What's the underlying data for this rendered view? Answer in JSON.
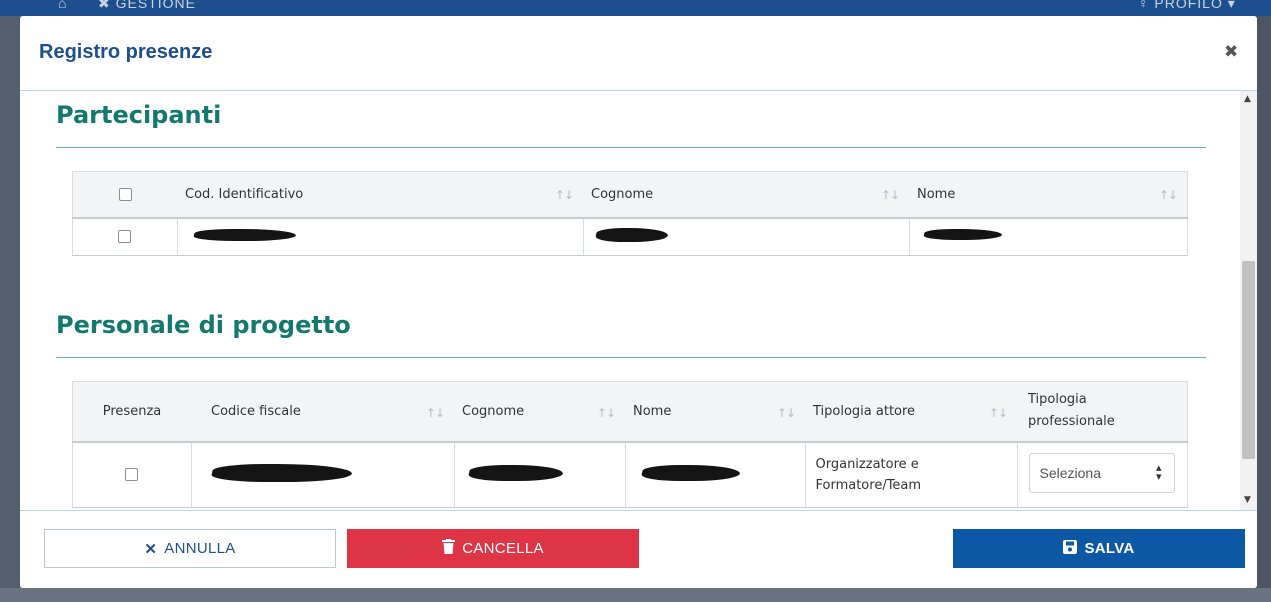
{
  "background": {
    "gestione_label": "GESTIONE",
    "profilo_label": "PROFILO"
  },
  "modal": {
    "title": "Registro presenze",
    "close_icon": "close-icon"
  },
  "partecipanti": {
    "title": "Partecipanti",
    "columns": [
      "Cod. Identificativo",
      "Cognome",
      "Nome"
    ],
    "rows": [
      {
        "selected": false,
        "cod": "",
        "cognome": "",
        "nome": ""
      }
    ]
  },
  "personale": {
    "title": "Personale di progetto",
    "columns": [
      "Presenza",
      "Codice fiscale",
      "Cognome",
      "Nome",
      "Tipologia attore",
      "Tipologia professionale"
    ],
    "rows": [
      {
        "presenza": false,
        "codice_fiscale": "",
        "cognome": "",
        "nome": "",
        "tipologia_attore_line1": "Organizzatore e",
        "tipologia_attore_line2": "Formatore/Team",
        "tipologia_professionale": "Seleziona"
      }
    ]
  },
  "footer": {
    "annulla_label": "ANNULLA",
    "cancella_label": "CANCELLA",
    "salva_label": "SALVA"
  },
  "colors": {
    "primary": "#0d58a5",
    "danger": "#dd3545",
    "section_title": "#13796f",
    "modal_title": "#1c4f8c"
  }
}
